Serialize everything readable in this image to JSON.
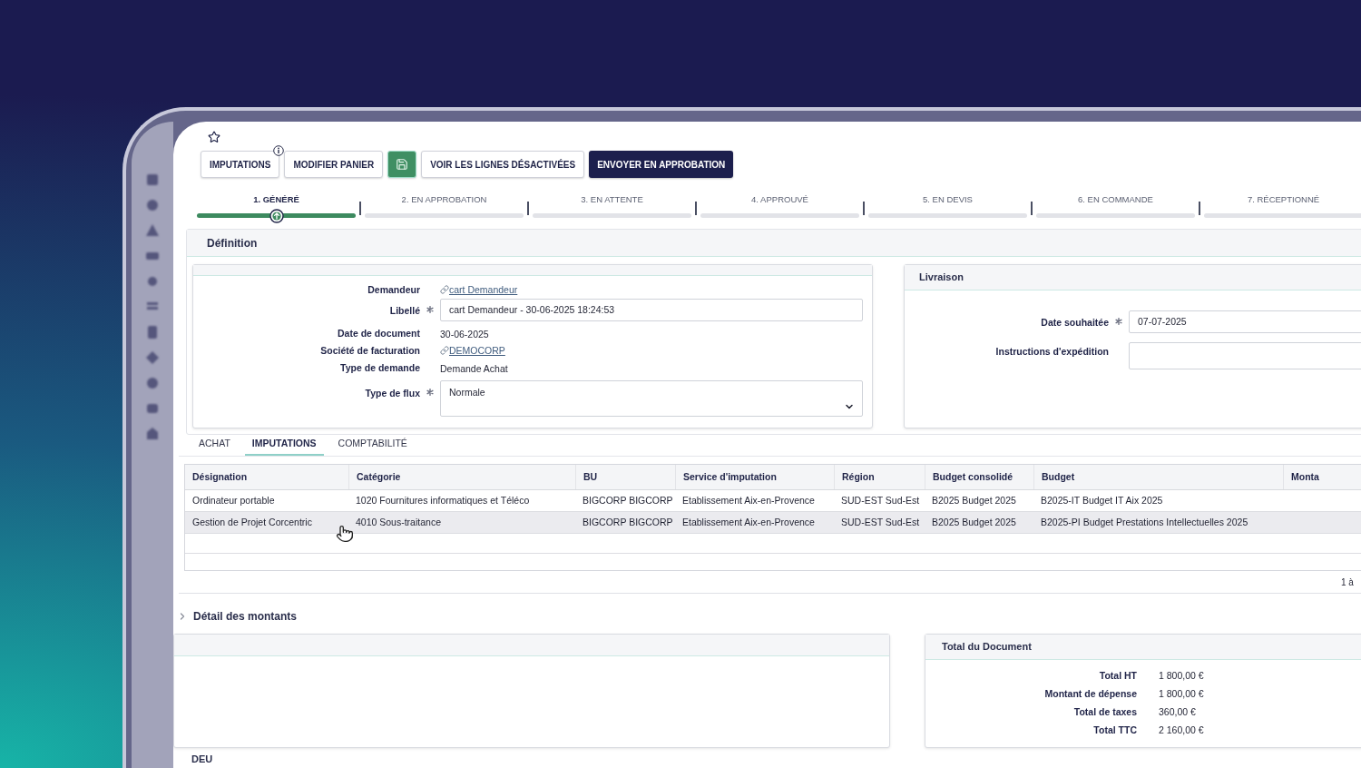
{
  "toolbar": [
    {
      "kind": "outline",
      "label": "IMPUTATIONS",
      "info": true
    },
    {
      "kind": "outline",
      "label": "MODIFIER PANIER",
      "info": false
    },
    {
      "kind": "icon",
      "info": false
    },
    {
      "kind": "outline",
      "label": "VOIR LES LIGNES DÉSACTIVÉES",
      "info": false
    },
    {
      "kind": "primary",
      "label": "ENVOYER EN APPROBATION",
      "info": false
    }
  ],
  "steps": [
    {
      "label": "1. GÉNÉRÉ",
      "selected": true
    },
    {
      "label": "2. EN APPROBATION",
      "selected": false
    },
    {
      "label": "3. EN ATTENTE",
      "selected": false
    },
    {
      "label": "4. APPROUVÉ",
      "selected": false
    },
    {
      "label": "5. EN DEVIS",
      "selected": false
    },
    {
      "label": "6. EN COMMANDE",
      "selected": false
    },
    {
      "label": "7. RÉCEPTIONNÉ",
      "selected": false
    }
  ],
  "definition": {
    "title": "Définition",
    "fields": [
      {
        "label": "Demandeur",
        "kind": "link",
        "required": false,
        "value": "cart Demandeur"
      },
      {
        "label": "Libellé",
        "kind": "input",
        "required": true,
        "value": "cart Demandeur - 30-06-2025 18:24:53"
      },
      {
        "label": "Date de document",
        "kind": "text",
        "required": false,
        "value": "30-06-2025"
      },
      {
        "label": "Société de facturation",
        "kind": "link",
        "required": false,
        "value": "DEMOCORP"
      },
      {
        "label": "Type de demande",
        "kind": "text",
        "required": false,
        "value": "Demande Achat"
      },
      {
        "label": "Type de flux",
        "kind": "select",
        "required": true,
        "value": "Normale"
      }
    ]
  },
  "delivery": {
    "title": "Livraison",
    "fields": [
      {
        "label": "Date souhaitée",
        "kind": "input",
        "required": true,
        "value": "07-07-2025"
      },
      {
        "label": "Instructions d'expédition",
        "kind": "textarea",
        "required": false
      }
    ]
  },
  "tabs": [
    {
      "label": "ACHAT",
      "selected": false
    },
    {
      "label": "IMPUTATIONS",
      "selected": true
    },
    {
      "label": "COMPTABILITÉ",
      "selected": false
    }
  ],
  "table": {
    "columns": [
      "Désignation",
      "Catégorie",
      "BU",
      "Service d'imputation",
      "Région",
      "Budget consolidé",
      "Budget",
      "Monta"
    ],
    "rows": [
      {
        "highlighted": false,
        "cells": [
          "Ordinateur portable",
          "1020 Fournitures informatiques et Téléco",
          "BIGCORP BIGCORP",
          "Etablissement Aix-en-Provence",
          "SUD-EST Sud-Est",
          "B2025 Budget 2025",
          "B2025-IT Budget IT Aix 2025"
        ]
      },
      {
        "highlighted": true,
        "cells": [
          "Gestion de Projet Corcentric",
          "4010 Sous-traitance",
          "BIGCORP BIGCORP",
          "Etablissement Aix-en-Provence",
          "SUD-EST Sud-Est",
          "B2025 Budget 2025",
          "B2025-PI Budget Prestations Intellectuelles 2025"
        ]
      }
    ]
  },
  "pagination": "1 à",
  "amount_details": {
    "title": "Détail des montants",
    "expanded": false
  },
  "document_total": {
    "title": "Total du Document",
    "rows": [
      {
        "label": "Total HT",
        "value": "1 800,00 €"
      },
      {
        "label": "Montant de dépense",
        "value": "1 800,00 €"
      },
      {
        "label": "Total de taxes",
        "value": "360,00 €"
      },
      {
        "label": "Total TTC",
        "value": "2 160,00 €"
      }
    ]
  },
  "next_section": {
    "title": "DEU"
  }
}
